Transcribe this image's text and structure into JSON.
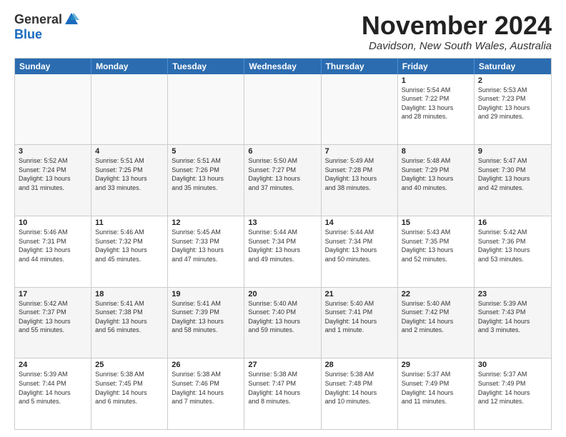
{
  "logo": {
    "general": "General",
    "blue": "Blue"
  },
  "title": "November 2024",
  "location": "Davidson, New South Wales, Australia",
  "dayHeaders": [
    "Sunday",
    "Monday",
    "Tuesday",
    "Wednesday",
    "Thursday",
    "Friday",
    "Saturday"
  ],
  "weeks": [
    [
      {
        "day": "",
        "info": ""
      },
      {
        "day": "",
        "info": ""
      },
      {
        "day": "",
        "info": ""
      },
      {
        "day": "",
        "info": ""
      },
      {
        "day": "",
        "info": ""
      },
      {
        "day": "1",
        "info": "Sunrise: 5:54 AM\nSunset: 7:22 PM\nDaylight: 13 hours\nand 28 minutes."
      },
      {
        "day": "2",
        "info": "Sunrise: 5:53 AM\nSunset: 7:23 PM\nDaylight: 13 hours\nand 29 minutes."
      }
    ],
    [
      {
        "day": "3",
        "info": "Sunrise: 5:52 AM\nSunset: 7:24 PM\nDaylight: 13 hours\nand 31 minutes."
      },
      {
        "day": "4",
        "info": "Sunrise: 5:51 AM\nSunset: 7:25 PM\nDaylight: 13 hours\nand 33 minutes."
      },
      {
        "day": "5",
        "info": "Sunrise: 5:51 AM\nSunset: 7:26 PM\nDaylight: 13 hours\nand 35 minutes."
      },
      {
        "day": "6",
        "info": "Sunrise: 5:50 AM\nSunset: 7:27 PM\nDaylight: 13 hours\nand 37 minutes."
      },
      {
        "day": "7",
        "info": "Sunrise: 5:49 AM\nSunset: 7:28 PM\nDaylight: 13 hours\nand 38 minutes."
      },
      {
        "day": "8",
        "info": "Sunrise: 5:48 AM\nSunset: 7:29 PM\nDaylight: 13 hours\nand 40 minutes."
      },
      {
        "day": "9",
        "info": "Sunrise: 5:47 AM\nSunset: 7:30 PM\nDaylight: 13 hours\nand 42 minutes."
      }
    ],
    [
      {
        "day": "10",
        "info": "Sunrise: 5:46 AM\nSunset: 7:31 PM\nDaylight: 13 hours\nand 44 minutes."
      },
      {
        "day": "11",
        "info": "Sunrise: 5:46 AM\nSunset: 7:32 PM\nDaylight: 13 hours\nand 45 minutes."
      },
      {
        "day": "12",
        "info": "Sunrise: 5:45 AM\nSunset: 7:33 PM\nDaylight: 13 hours\nand 47 minutes."
      },
      {
        "day": "13",
        "info": "Sunrise: 5:44 AM\nSunset: 7:34 PM\nDaylight: 13 hours\nand 49 minutes."
      },
      {
        "day": "14",
        "info": "Sunrise: 5:44 AM\nSunset: 7:34 PM\nDaylight: 13 hours\nand 50 minutes."
      },
      {
        "day": "15",
        "info": "Sunrise: 5:43 AM\nSunset: 7:35 PM\nDaylight: 13 hours\nand 52 minutes."
      },
      {
        "day": "16",
        "info": "Sunrise: 5:42 AM\nSunset: 7:36 PM\nDaylight: 13 hours\nand 53 minutes."
      }
    ],
    [
      {
        "day": "17",
        "info": "Sunrise: 5:42 AM\nSunset: 7:37 PM\nDaylight: 13 hours\nand 55 minutes."
      },
      {
        "day": "18",
        "info": "Sunrise: 5:41 AM\nSunset: 7:38 PM\nDaylight: 13 hours\nand 56 minutes."
      },
      {
        "day": "19",
        "info": "Sunrise: 5:41 AM\nSunset: 7:39 PM\nDaylight: 13 hours\nand 58 minutes."
      },
      {
        "day": "20",
        "info": "Sunrise: 5:40 AM\nSunset: 7:40 PM\nDaylight: 13 hours\nand 59 minutes."
      },
      {
        "day": "21",
        "info": "Sunrise: 5:40 AM\nSunset: 7:41 PM\nDaylight: 14 hours\nand 1 minute."
      },
      {
        "day": "22",
        "info": "Sunrise: 5:40 AM\nSunset: 7:42 PM\nDaylight: 14 hours\nand 2 minutes."
      },
      {
        "day": "23",
        "info": "Sunrise: 5:39 AM\nSunset: 7:43 PM\nDaylight: 14 hours\nand 3 minutes."
      }
    ],
    [
      {
        "day": "24",
        "info": "Sunrise: 5:39 AM\nSunset: 7:44 PM\nDaylight: 14 hours\nand 5 minutes."
      },
      {
        "day": "25",
        "info": "Sunrise: 5:38 AM\nSunset: 7:45 PM\nDaylight: 14 hours\nand 6 minutes."
      },
      {
        "day": "26",
        "info": "Sunrise: 5:38 AM\nSunset: 7:46 PM\nDaylight: 14 hours\nand 7 minutes."
      },
      {
        "day": "27",
        "info": "Sunrise: 5:38 AM\nSunset: 7:47 PM\nDaylight: 14 hours\nand 8 minutes."
      },
      {
        "day": "28",
        "info": "Sunrise: 5:38 AM\nSunset: 7:48 PM\nDaylight: 14 hours\nand 10 minutes."
      },
      {
        "day": "29",
        "info": "Sunrise: 5:37 AM\nSunset: 7:49 PM\nDaylight: 14 hours\nand 11 minutes."
      },
      {
        "day": "30",
        "info": "Sunrise: 5:37 AM\nSunset: 7:49 PM\nDaylight: 14 hours\nand 12 minutes."
      }
    ]
  ]
}
